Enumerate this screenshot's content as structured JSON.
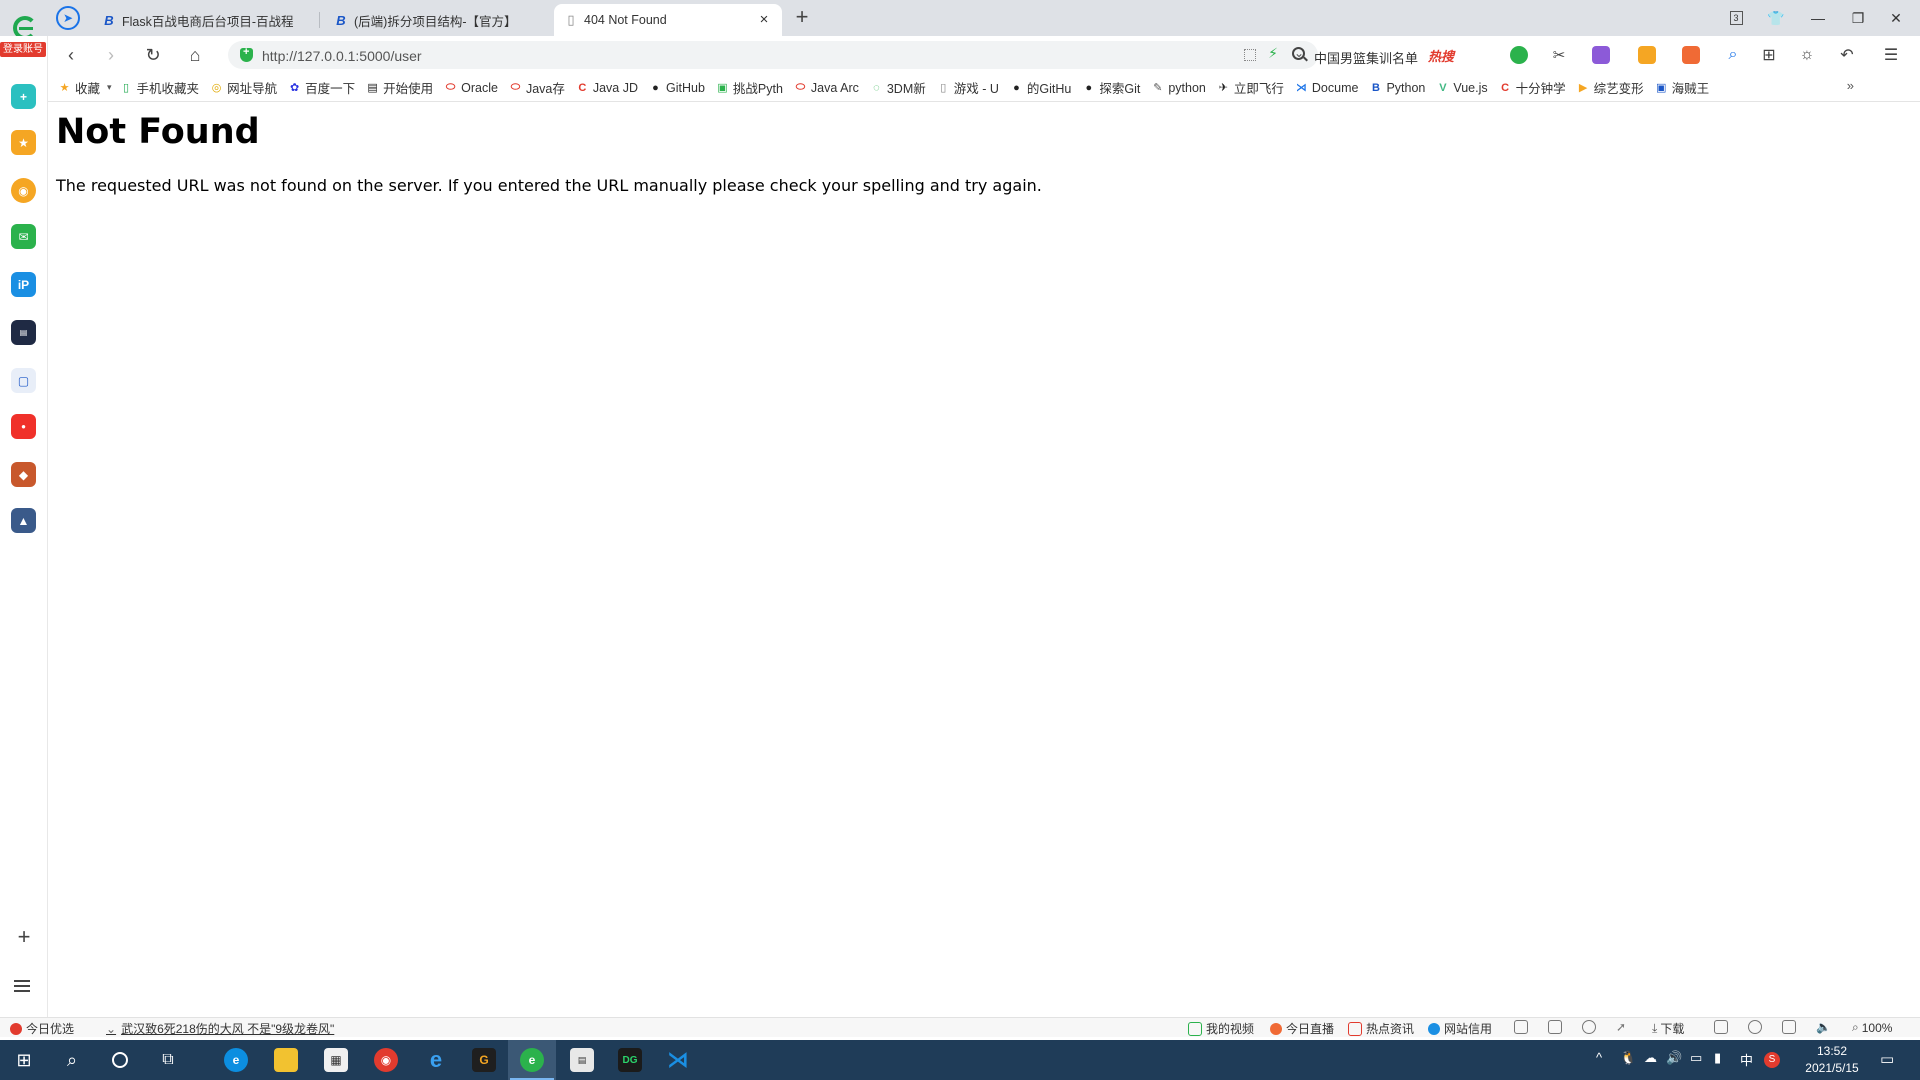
{
  "browser": {
    "login_badge": "登录账号",
    "tabs": [
      {
        "title": "Flask百战电商后台项目-百战程",
        "active": false
      },
      {
        "title": "(后端)拆分项目结构-【官方】",
        "active": false
      },
      {
        "title": "404 Not Found",
        "active": true
      }
    ],
    "tab_count": "3",
    "address": {
      "url": "http://127.0.0.1:5000/user"
    },
    "search": {
      "text": "中国男篮集训名单",
      "hot_badge": "热搜"
    }
  },
  "bookmarks": [
    {
      "label": "收藏",
      "icon": "star-icon",
      "color": "#f5a623"
    },
    {
      "label": "手机收藏夹",
      "icon": "phone-icon",
      "color": "#1fa84f"
    },
    {
      "label": "网址导航",
      "icon": "compass-icon",
      "color": "#e0a800"
    },
    {
      "label": "百度一下",
      "icon": "paw-icon",
      "color": "#2932e1"
    },
    {
      "label": "开始使用",
      "icon": "book-icon",
      "color": "#222222"
    },
    {
      "label": "Oracle",
      "icon": "oracle-icon",
      "color": "#e23b2e"
    },
    {
      "label": "Java存",
      "icon": "oracle-icon",
      "color": "#e23b2e"
    },
    {
      "label": "Java JD",
      "icon": "csdn-icon",
      "color": "#e23b2e"
    },
    {
      "label": "GitHub",
      "icon": "github-icon",
      "color": "#222222"
    },
    {
      "label": "挑战Pyth",
      "icon": "page-icon",
      "color": "#2bb24c"
    },
    {
      "label": "Java Arc",
      "icon": "oracle-icon",
      "color": "#e23b2e"
    },
    {
      "label": "3DM新",
      "icon": "ring-icon",
      "color": "#2bb24c"
    },
    {
      "label": "游戏 - U",
      "icon": "doc-icon",
      "color": "#888888"
    },
    {
      "label": "的GitHu",
      "icon": "github-icon",
      "color": "#222222"
    },
    {
      "label": "探索Git",
      "icon": "github-icon",
      "color": "#222222"
    },
    {
      "label": "python",
      "icon": "feather-icon",
      "color": "#555555"
    },
    {
      "label": "立即飞行",
      "icon": "plane-icon",
      "color": "#222222"
    },
    {
      "label": "Docume",
      "icon": "vscode-icon",
      "color": "#1a73e8"
    },
    {
      "label": "Python",
      "icon": "bz-icon",
      "color": "#1a56c7"
    },
    {
      "label": "Vue.js",
      "icon": "vue-icon",
      "color": "#41b883"
    },
    {
      "label": "十分钟学",
      "icon": "csdn-icon",
      "color": "#e23b2e"
    },
    {
      "label": "综艺变形",
      "icon": "play-icon",
      "color": "#f5a623"
    },
    {
      "label": "海贼王",
      "icon": "video-icon",
      "color": "#1a56c7"
    }
  ],
  "bookmarks_more": "»",
  "page": {
    "heading": "Not Found",
    "message": "The requested URL was not found on the server. If you entered the URL manually please check your spelling and try again."
  },
  "statusbar": {
    "left_item": "今日优选",
    "news": "武汉致6死218伤的大风 不是\"9级龙卷风\"",
    "right_items": [
      "我的视频",
      "今日直播",
      "热点资讯",
      "网站信用"
    ],
    "download": "下载",
    "zoom": "100%"
  },
  "taskbar": {
    "ime": "中",
    "time": "13:52",
    "date": "2021/5/15"
  },
  "colors": {
    "tabbar": "#dee1e6",
    "taskbar": "#1f3c58",
    "accent_green": "#2bb24c",
    "hot_red": "#e23b2e"
  }
}
